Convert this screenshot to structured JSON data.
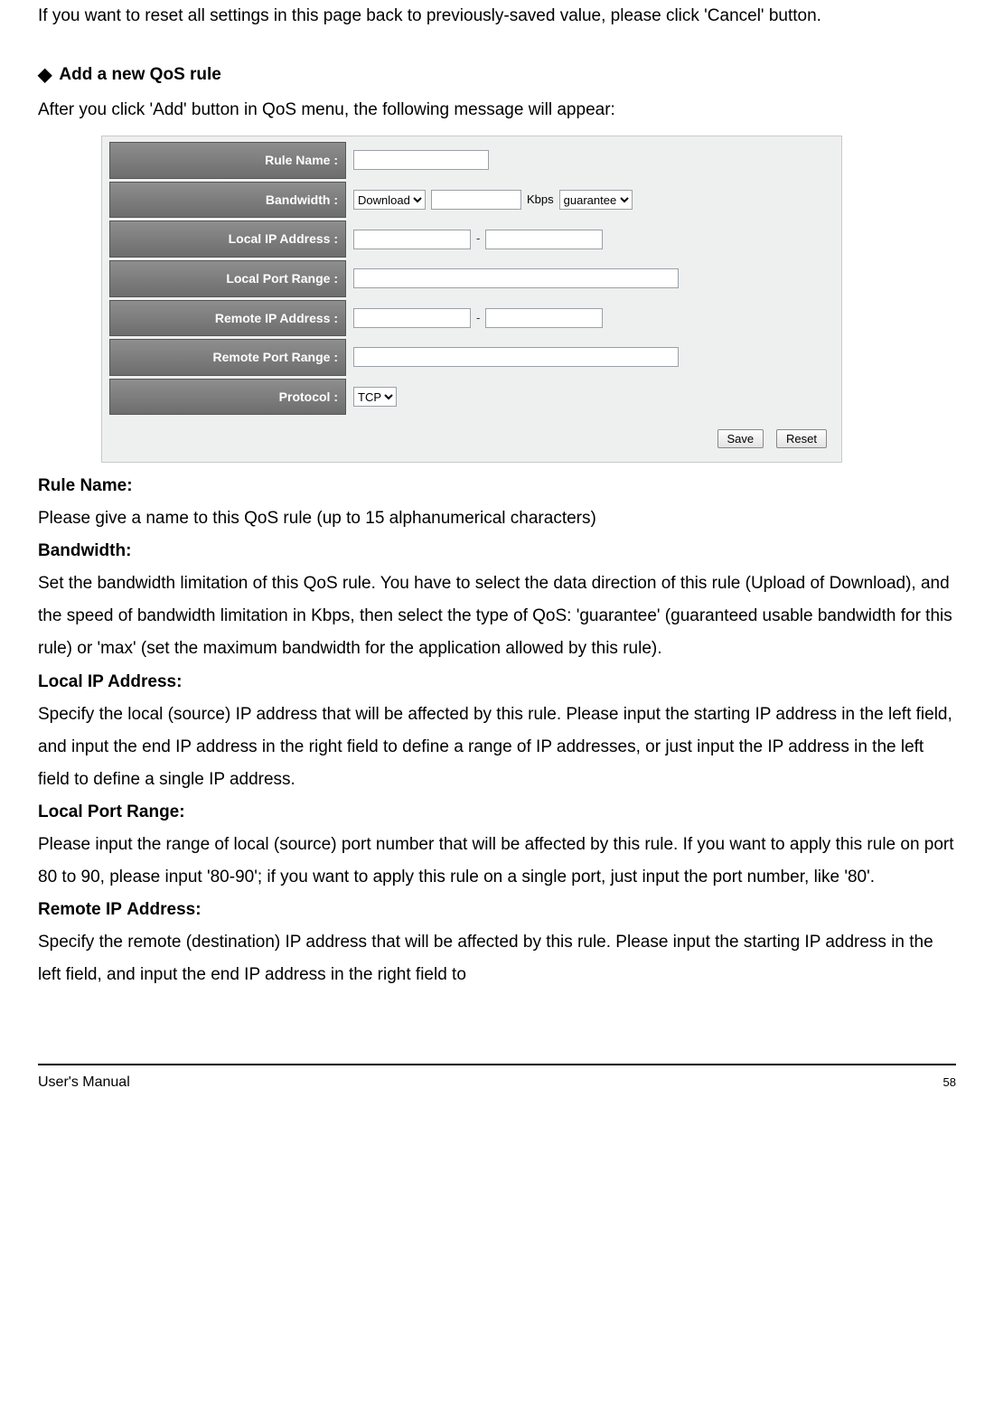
{
  "intro": "If you want to reset all settings in this page back to previously-saved value, please click 'Cancel' button.",
  "section_title": "Add a new QoS rule",
  "after_header": "After you click 'Add' button in QoS menu, the following message will appear:",
  "form": {
    "rule_name_label": "Rule Name :",
    "bandwidth_label": "Bandwidth :",
    "bandwidth_direction": "Download",
    "bandwidth_unit": "Kbps",
    "bandwidth_type": "guarantee",
    "local_ip_label": "Local IP Address :",
    "local_port_label": "Local Port Range :",
    "remote_ip_label": "Remote IP Address :",
    "remote_port_label": "Remote Port Range :",
    "protocol_label": "Protocol :",
    "protocol_value": "TCP",
    "save_btn": "Save",
    "reset_btn": "Reset",
    "dash": "-"
  },
  "defs": {
    "rule_name_t": "Rule Name:",
    "rule_name_d": "Please give a name to this QoS rule (up to 15 alphanumerical characters)",
    "bandwidth_t": "Bandwidth:",
    "bandwidth_d": "Set the bandwidth limitation of this QoS rule. You have to select the data direction of this rule (Upload of Download), and the speed of bandwidth limitation in Kbps, then select the type of QoS: 'guarantee' (guaranteed usable bandwidth for this rule) or 'max' (set the maximum bandwidth for the application allowed by this rule).",
    "local_ip_t": "Local IP Address:",
    "local_ip_d": "Specify the local (source) IP address that will be affected by this rule. Please input the starting IP address in the left field, and input the end IP address in the right field to define a range of IP addresses, or just input the IP address in the left field to define a single IP address.",
    "local_port_t": "Local Port Range:",
    "local_port_d": "Please input the range of local (source) port number that will be affected by this rule. If you want to apply this rule on port 80 to 90, please input '80-90'; if you want to apply this rule on a single port, just input the port number, like '80'.",
    "remote_ip_t": "Remote IP Address:",
    "remote_ip_d": "Specify the remote (destination) IP address that will be affected by this rule. Please input the starting IP address in the left field, and input the end IP address in the right field to"
  },
  "footer": {
    "label": "User's Manual",
    "page": "58"
  }
}
